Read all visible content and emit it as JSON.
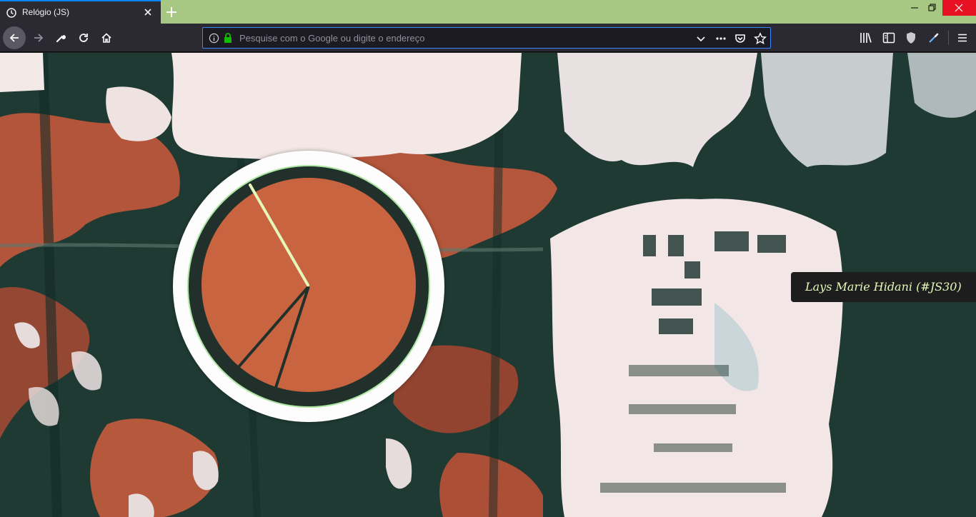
{
  "browser": {
    "tab_title": "Relógio (JS)",
    "url_placeholder": "Pesquise com o Google ou digite o endereço",
    "url_value": ""
  },
  "page": {
    "credit": "Lays Marie Hidani (#JS30)"
  },
  "clock": {
    "hour_hand_deg": 221,
    "minute_hand_deg": 198,
    "second_hand_deg": 330,
    "hour_hand_color": "#21302a",
    "minute_hand_color": "#21302a",
    "second_hand_color": "#e6f8b9"
  },
  "colors": {
    "tab_bar": "#a6c882",
    "chrome": "#2b2a33",
    "clock_fill": "#c96440",
    "clock_ring": "#fdfdfd",
    "accent": "#3a86ff",
    "close_red": "#e81123"
  },
  "icons": {
    "tab": "clock-icon",
    "back": "arrow-left-icon",
    "forward": "arrow-right-icon",
    "customize": "wrench-icon",
    "reload": "reload-icon",
    "home": "home-icon",
    "info": "info-icon",
    "lock": "lock-icon",
    "dropdown": "chevron-down-icon",
    "page_actions": "ellipsis-icon",
    "pocket": "pocket-icon",
    "bookmark": "star-icon",
    "library": "library-icon",
    "sidebar": "sidebar-icon",
    "shield": "shield-icon",
    "eyedropper": "eyedropper-icon",
    "menu": "hamburger-icon"
  }
}
